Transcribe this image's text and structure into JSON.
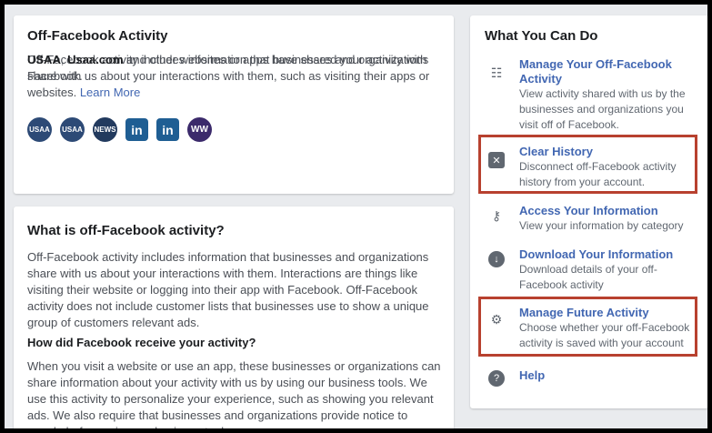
{
  "off_fb_card": {
    "title": "Off-Facebook Activity",
    "desc": "Off-Facebook activity includes information that businesses and organizations share with us about your interactions with them, such as visiting their apps or websites.",
    "learn_more": "Learn More",
    "logos": [
      "USAA",
      "USAA",
      "NEWS",
      "in",
      "in",
      "WW"
    ],
    "shared_bold1": "USAA",
    "shared_sep": ", ",
    "shared_bold2": "Usaa.com",
    "shared_rest": " and other websites or apps have shared your activity with Facebook."
  },
  "what_is_card": {
    "title": "What is off-Facebook activity?",
    "p1": "Off-Facebook activity includes information that businesses and organizations share with us about your interactions with them. Interactions are things like visiting their website or logging into their app with Facebook. Off-Facebook activity does not include customer lists that businesses use to show a unique group of customers relevant ads.",
    "sub": "How did Facebook receive your activity?",
    "p2": "When you visit a website or use an app, these businesses or organizations can share information about your activity with us by using our business tools. We use this activity to personalize your experience, such as showing you relevant ads. We also require that businesses and organizations provide notice to people before using our business tools."
  },
  "actions_card": {
    "title": "What You Can Do",
    "items": [
      {
        "title": "Manage Your Off-Facebook Activity",
        "desc": "View activity shared with us by the businesses and organizations you visit off of Facebook.",
        "icon": "list-settings-icon"
      },
      {
        "title": "Clear History",
        "desc": "Disconnect off-Facebook activity history from your account.",
        "icon": "clear-x-icon"
      },
      {
        "title": "Access Your Information",
        "desc": "View your information by category",
        "icon": "key-icon"
      },
      {
        "title": "Download Your Information",
        "desc": "Download details of your off-Facebook activity",
        "icon": "download-icon"
      },
      {
        "title": "Manage Future Activity",
        "desc": "Choose whether your off-Facebook activity is saved with your account",
        "icon": "gear-icon"
      },
      {
        "title": "Help",
        "desc": "",
        "icon": "help-icon"
      }
    ]
  },
  "colors": {
    "link": "#4267b2",
    "highlight": "#b8412f",
    "background": "#e9ebee"
  }
}
